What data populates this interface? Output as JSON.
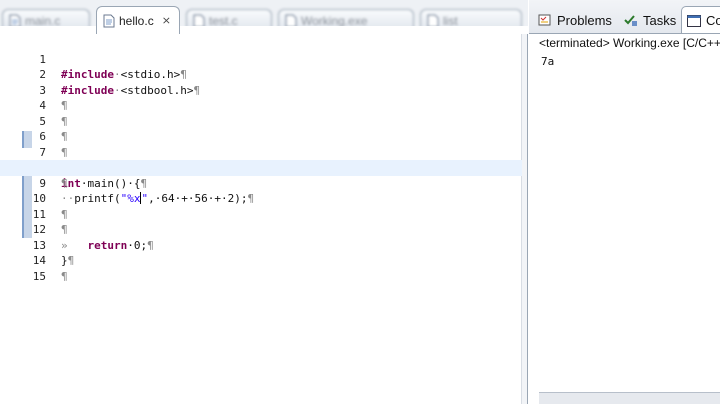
{
  "editor": {
    "tabs": [
      {
        "label": "main.c",
        "blurred": true
      },
      {
        "label": "hello.c",
        "blurred": false,
        "active": true
      },
      {
        "label": "test.c",
        "blurred": true
      },
      {
        "label": "Working.exe",
        "blurred": true
      },
      {
        "label": "list",
        "blurred": true
      }
    ],
    "close_glyph": "⨯",
    "line_numbers": [
      "1",
      "2",
      "3",
      "4",
      "5",
      "6",
      "7",
      "8",
      "9",
      "10",
      "11",
      "12",
      "13",
      "14",
      "15"
    ],
    "fold_glyph": "⊖",
    "lines": {
      "l1": {
        "kw": "#include",
        "sp": "·",
        "rest": "<stdio.h>",
        "nl": "¶"
      },
      "l2": {
        "kw": "#include",
        "sp": "·",
        "rest": "<stdbool.h>",
        "nl": "¶"
      },
      "l3": "¶",
      "l4": "¶",
      "l5": "¶",
      "l6": "¶",
      "l7": {
        "kw": "int",
        "rest": "·main()·{",
        "nl": "¶"
      },
      "l8": "¶",
      "l9": {
        "lead": "··",
        "pre": "printf(",
        "str_a": "\"%x",
        "str_b": "\"",
        "post": ",·64·+·56·+·2);",
        "nl": "¶"
      },
      "l10": "¶",
      "l11": "¶",
      "l12": {
        "lead": "»   ",
        "kw": "return",
        "rest": "·0;",
        "nl": "¶"
      },
      "l13": {
        "text": "}",
        "nl": "¶"
      },
      "l14": "¶",
      "l15": ""
    }
  },
  "console": {
    "tabs": [
      {
        "label": "Problems"
      },
      {
        "label": "Tasks"
      },
      {
        "label": "Co"
      }
    ],
    "title": "<terminated> Working.exe [C/C++",
    "output": "7a"
  },
  "colors": {
    "keyword": "#7f0055",
    "string": "#2a00ff",
    "current_line": "#e8f2fe"
  }
}
